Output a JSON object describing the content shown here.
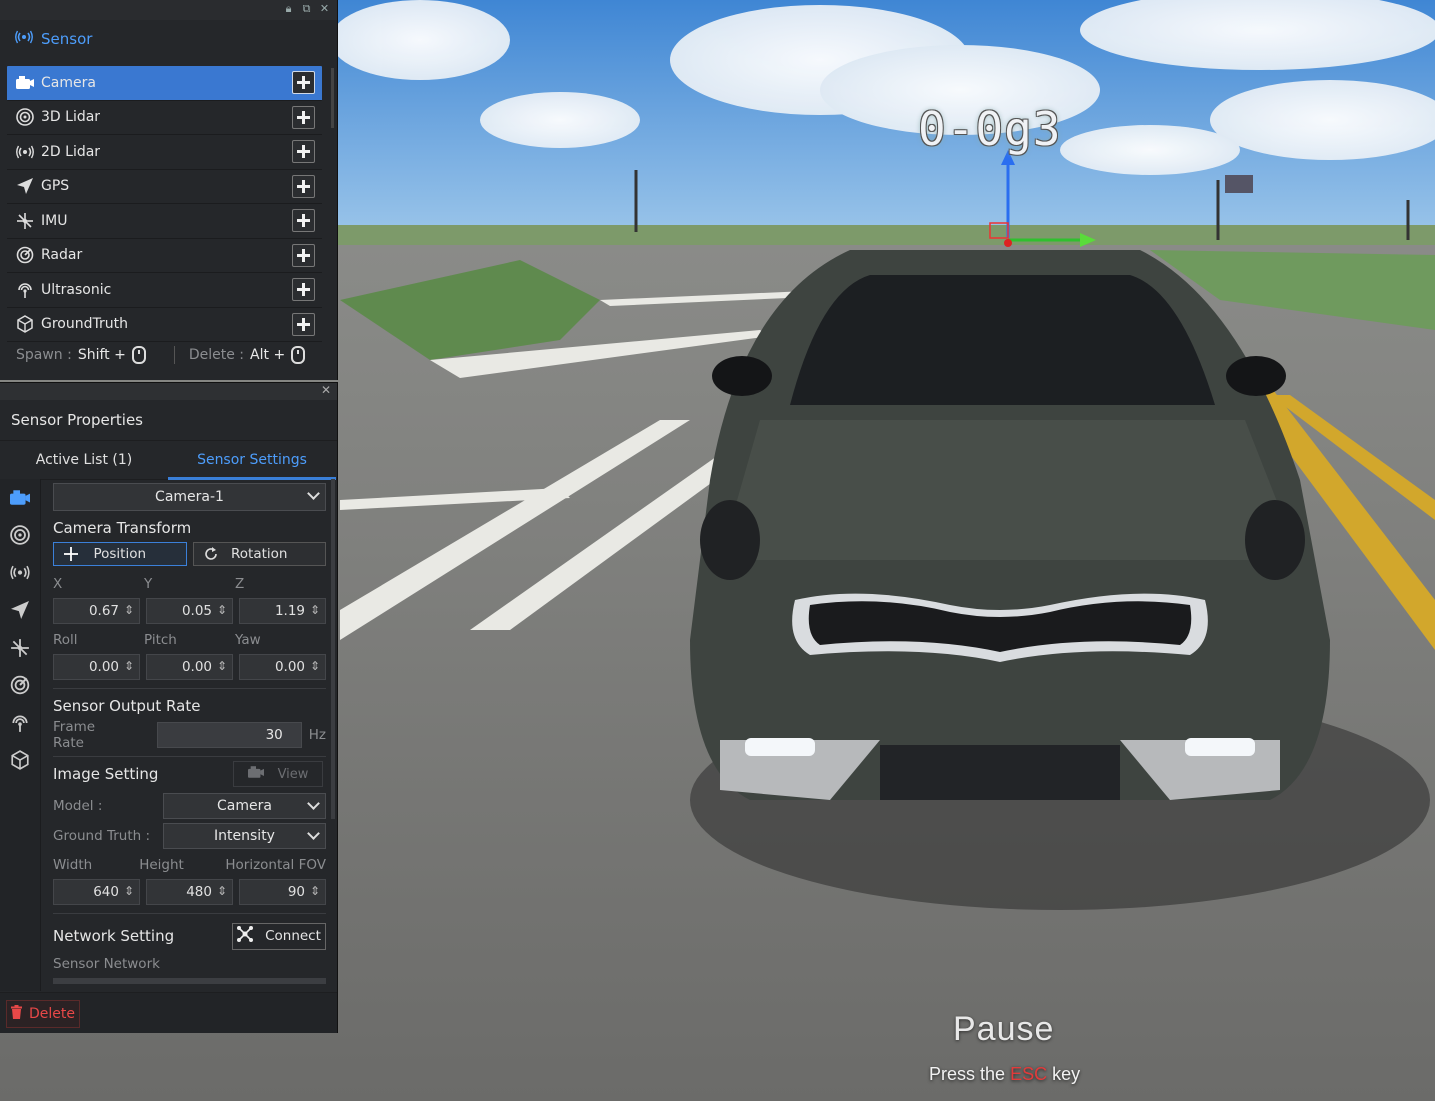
{
  "sensor_panel": {
    "title": "Sensor",
    "items": [
      {
        "label": "Camera",
        "icon": "camera-icon",
        "active": true
      },
      {
        "label": "3D Lidar",
        "icon": "lidar3d-icon",
        "active": false
      },
      {
        "label": "2D Lidar",
        "icon": "lidar2d-icon",
        "active": false
      },
      {
        "label": "GPS",
        "icon": "gps-icon",
        "active": false
      },
      {
        "label": "IMU",
        "icon": "imu-icon",
        "active": false
      },
      {
        "label": "Radar",
        "icon": "radar-icon",
        "active": false
      },
      {
        "label": "Ultrasonic",
        "icon": "ultrasonic-icon",
        "active": false
      },
      {
        "label": "GroundTruth",
        "icon": "groundtruth-icon",
        "active": false
      }
    ],
    "spawn_label": "Spawn :",
    "spawn_key": "Shift +",
    "delete_label": "Delete :",
    "delete_key": "Alt +"
  },
  "properties": {
    "title": "Sensor Properties",
    "tabs": [
      "Active List (1)",
      "Sensor Settings"
    ],
    "active_tab": 1,
    "selected_sensor": "Camera-1",
    "camera_transform": {
      "title": "Camera Transform",
      "position_label": "Position",
      "rotation_label": "Rotation",
      "pos_labels": [
        "X",
        "Y",
        "Z"
      ],
      "pos_values": [
        "0.67",
        "0.05",
        "1.19"
      ],
      "rot_labels": [
        "Roll",
        "Pitch",
        "Yaw"
      ],
      "rot_values": [
        "0.00",
        "0.00",
        "0.00"
      ]
    },
    "output_rate": {
      "title": "Sensor Output Rate",
      "frame_rate_label": "Frame Rate",
      "frame_rate_value": "30",
      "unit": "Hz"
    },
    "image_setting": {
      "title": "Image Setting",
      "view_label": "View",
      "model_label": "Model :",
      "model_value": "Camera",
      "gt_label": "Ground Truth :",
      "gt_value": "Intensity",
      "dim_labels": [
        "Width",
        "Height",
        "Horizontal FOV"
      ],
      "dim_values": [
        "640",
        "480",
        "90"
      ]
    },
    "network_setting": {
      "title": "Network Setting",
      "connect_label": "Connect",
      "sensor_network_label": "Sensor Network"
    },
    "delete_label": "Delete"
  },
  "viewport": {
    "vehicle_tag": "0-0g3",
    "pause_title": "Pause",
    "pause_hint_pre": "Press the",
    "pause_hint_key": "ESC",
    "pause_hint_post": "key"
  },
  "colors": {
    "accent": "#3a78d1",
    "panel_bg": "#25272a",
    "danger": "#e84848"
  }
}
